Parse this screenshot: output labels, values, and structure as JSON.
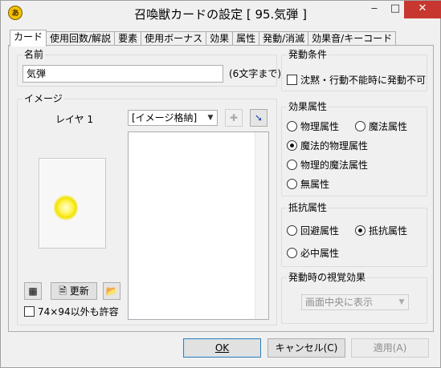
{
  "window": {
    "title": "召喚獣カードの設定 [ 95.気弾 ]",
    "minimize_glyph": "‒",
    "maximize_glyph": "□",
    "close_glyph": "✕",
    "app_icon": "summon-card-icon"
  },
  "tabs": [
    {
      "label": "カード",
      "active": true
    },
    {
      "label": "使用回数/解説",
      "active": false
    },
    {
      "label": "要素",
      "active": false
    },
    {
      "label": "使用ボーナス",
      "active": false
    },
    {
      "label": "効果",
      "active": false
    },
    {
      "label": "属性",
      "active": false
    },
    {
      "label": "発動/消滅",
      "active": false
    },
    {
      "label": "効果音/キーコード",
      "active": false
    }
  ],
  "name_group": {
    "label": "名前",
    "value": "気弾",
    "hint": "(6文字まで)"
  },
  "image_group": {
    "label": "イメージ",
    "layer_label": "レイヤ 1",
    "store_select": "[イメージ格納]",
    "refresh_button": "更新",
    "allow_size_checkbox": "74×94以外も許容"
  },
  "trigger_conditions": {
    "label": "発動条件",
    "checkbox": "沈黙・行動不能時に発動不可"
  },
  "effect_attribute": {
    "label": "効果属性",
    "options": [
      {
        "label": "物理属性",
        "checked": false
      },
      {
        "label": "魔法属性",
        "checked": false
      },
      {
        "label": "魔法的物理属性",
        "checked": true
      },
      {
        "label": "物理的魔法属性",
        "checked": false
      },
      {
        "label": "無属性",
        "checked": false
      }
    ]
  },
  "resist_attribute": {
    "label": "抵抗属性",
    "options": [
      {
        "label": "回避属性",
        "checked": false
      },
      {
        "label": "抵抗属性",
        "checked": true
      },
      {
        "label": "必中属性",
        "checked": false
      }
    ]
  },
  "visual_effect": {
    "label": "発動時の視覚効果",
    "value": "画面中央に表示"
  },
  "footer": {
    "ok": "OK",
    "cancel": "キャンセル(C)",
    "apply": "適用(A)"
  }
}
